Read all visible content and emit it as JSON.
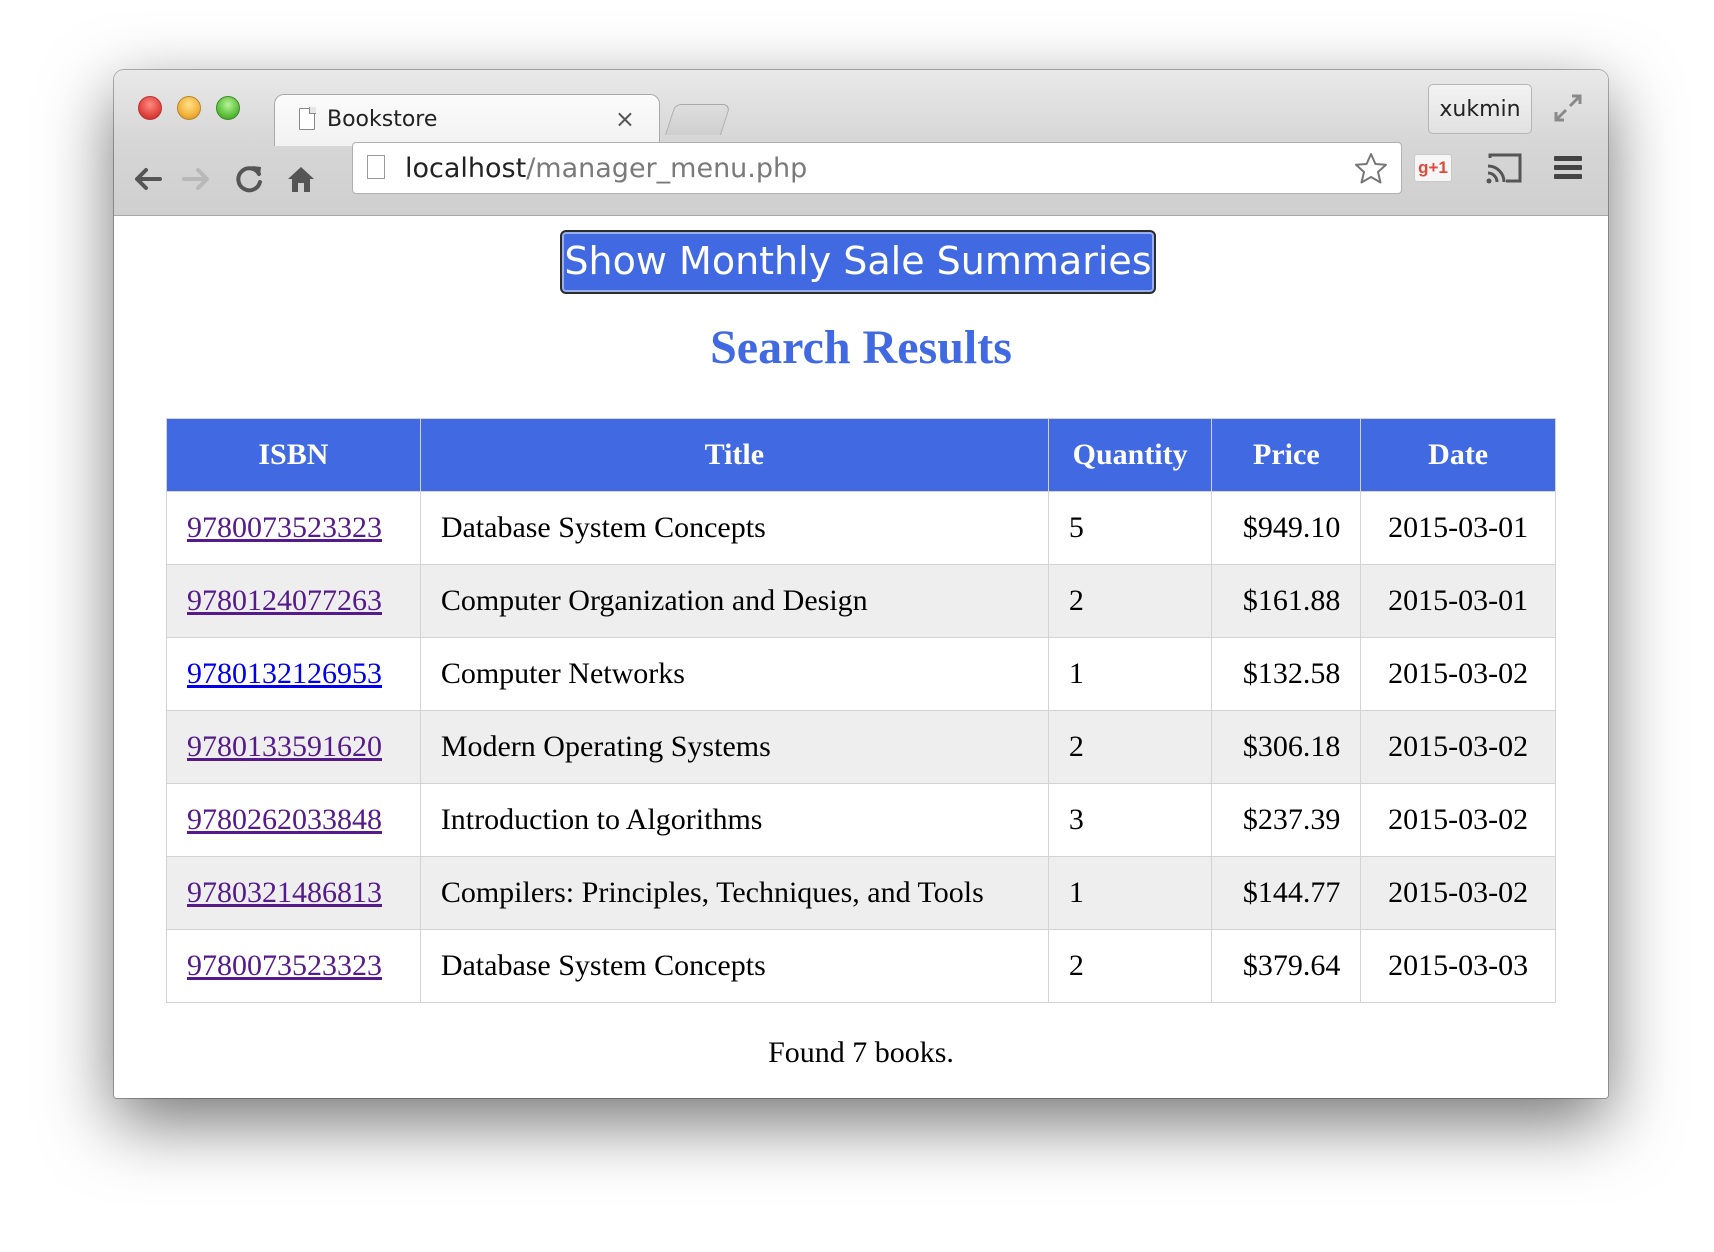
{
  "browser": {
    "tab_title": "Bookstore",
    "tab_close": "×",
    "user_name": "xukmin",
    "url_host": "localhost",
    "url_path": "/manager_menu.php",
    "gplus_label": "g+1"
  },
  "page": {
    "summary_button_label": "Show Monthly Sale Summaries",
    "results_heading": "Search Results",
    "found_text": "Found 7 books."
  },
  "table": {
    "headers": {
      "isbn": "ISBN",
      "title": "Title",
      "quantity": "Quantity",
      "price": "Price",
      "date": "Date"
    },
    "rows": [
      {
        "isbn": "9780073523323",
        "title": "Database System Concepts",
        "quantity": "5",
        "price": "$949.10",
        "date": "2015-03-01"
      },
      {
        "isbn": "9780124077263",
        "title": "Computer Organization and Design",
        "quantity": "2",
        "price": "$161.88",
        "date": "2015-03-01"
      },
      {
        "isbn": "9780132126953",
        "title": "Computer Networks",
        "quantity": "1",
        "price": "$132.58",
        "date": "2015-03-02"
      },
      {
        "isbn": "9780133591620",
        "title": "Modern Operating Systems",
        "quantity": "2",
        "price": "$306.18",
        "date": "2015-03-02"
      },
      {
        "isbn": "9780262033848",
        "title": "Introduction to Algorithms",
        "quantity": "3",
        "price": "$237.39",
        "date": "2015-03-02"
      },
      {
        "isbn": "9780321486813",
        "title": "Compilers: Principles, Techniques, and Tools",
        "quantity": "1",
        "price": "$144.77",
        "date": "2015-03-02"
      },
      {
        "isbn": "9780073523323",
        "title": "Database System Concepts",
        "quantity": "2",
        "price": "$379.64",
        "date": "2015-03-03"
      }
    ]
  },
  "colors": {
    "accent": "#4169e1",
    "visited_link": "#551a8b",
    "unvisited_link": "#0000ee",
    "alt_row": "#eeeeee"
  }
}
